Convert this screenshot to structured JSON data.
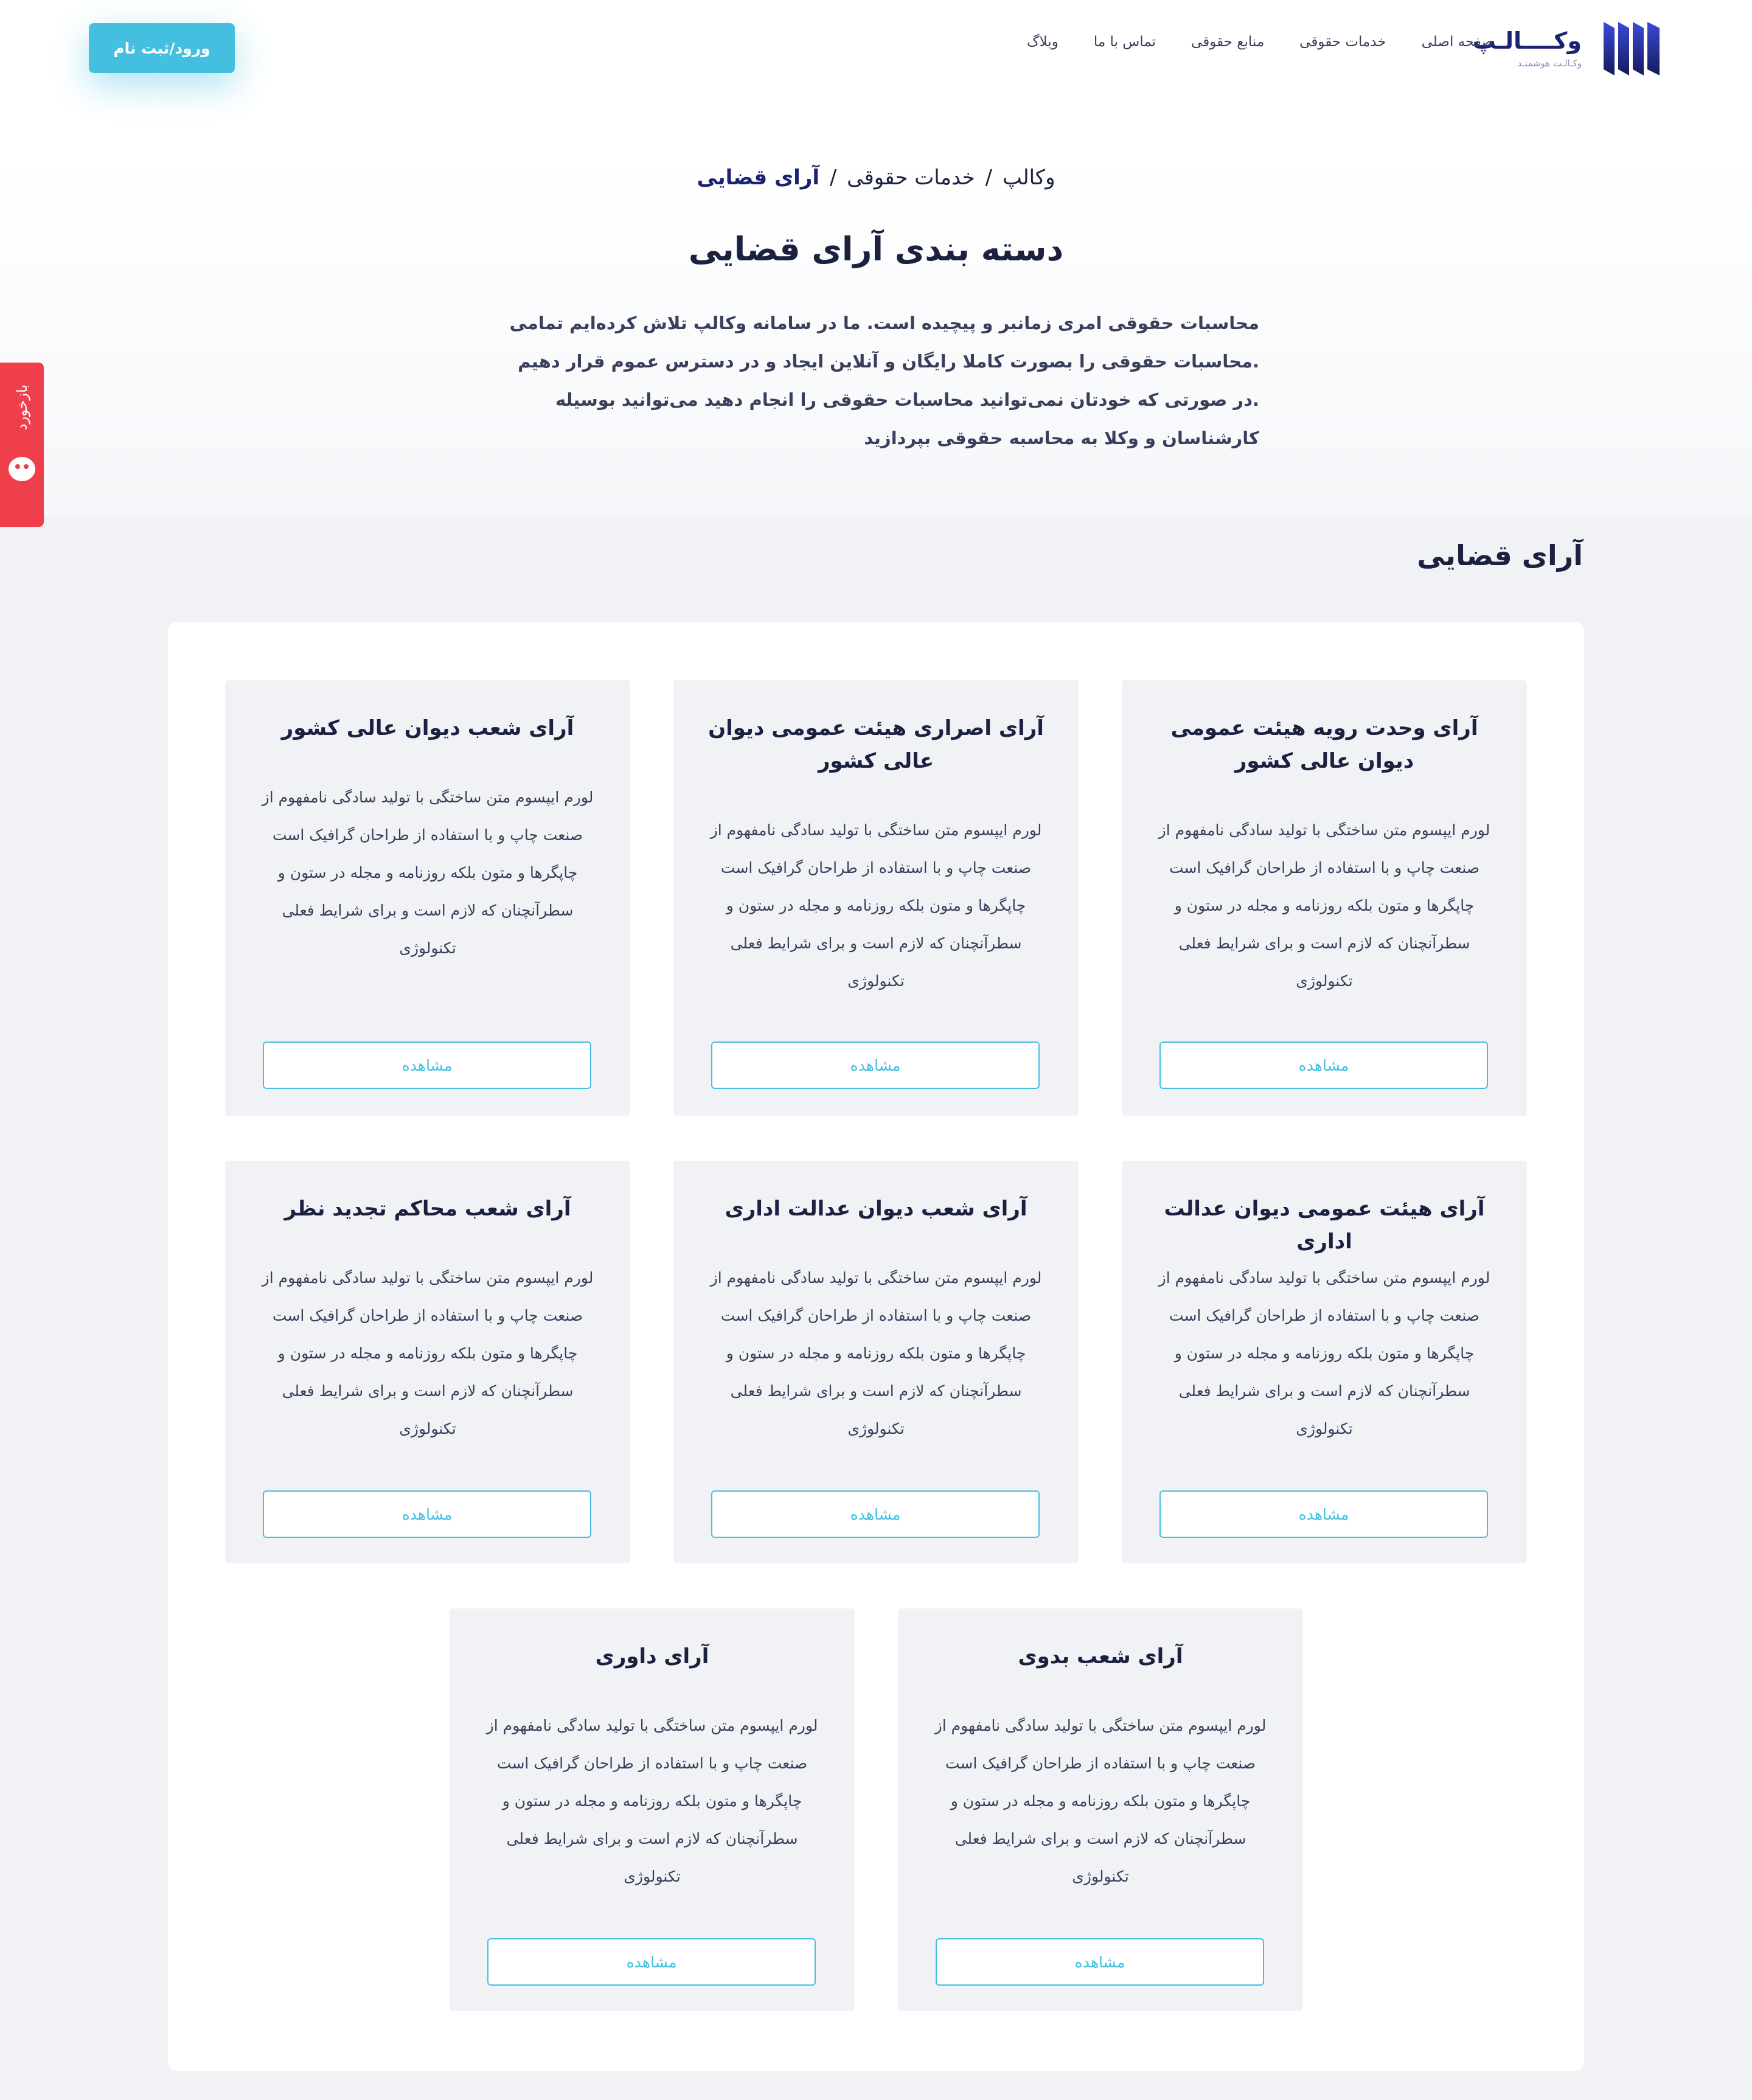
{
  "header": {
    "logo": {
      "name": "وکــــالـپ",
      "tagline": "وکـالـت هوشمنـد"
    },
    "nav": [
      "صفحه اصلی",
      "خدمات حقوقی",
      "منابع حقوقی",
      "تماس با ما",
      "وبلاگ"
    ],
    "login_label": "ورود/ثبت نام"
  },
  "breadcrumb": {
    "home": "وکالپ",
    "parent": "خدمات حقوقی",
    "current": "آرای قضایی",
    "separator": "/"
  },
  "page": {
    "title": "دسته بندی آرای قضایی",
    "intro": "محاسبات حقوقی امری زمانبر و پیچیده است. ما در سامانه وکالپ تلاش کرده‌ایم تمامی .محاسبات حقوقی را بصورت کاملا رایگان و آنلاین ایجاد و در دسترس عموم قرار دهیم .در صورتی که خودتان نمی‌توانید محاسبات حقوقی را انجام دهید می‌توانید بوسیله کارشناسان و وکلا به محاسبه حقوقی بپردازید"
  },
  "feedback": {
    "label": "بازخورد"
  },
  "section": {
    "title": "آرای قضایی"
  },
  "cards": [
    {
      "title": "آرای وحدت رویه هیئت عمومی دیوان عالی کشور",
      "text": "لورم ایپسوم متن ساختگی با تولید سادگی نامفهوم از صنعت چاپ و با استفاده از طراحان گرافیک است چاپگرها و متون بلکه روزنامه و مجله در ستون و سطرآنچنان که لازم است و برای شرایط فعلی تکنولوژی",
      "button": "مشاهده"
    },
    {
      "title": "آرای اصراری هیئت عمومی دیوان عالی کشور",
      "text": "لورم ایپسوم متن ساختگی با تولید سادگی نامفهوم از صنعت چاپ و با استفاده از طراحان گرافیک است چاپگرها و متون بلکه روزنامه و مجله در ستون و سطرآنچنان که لازم است و برای شرایط فعلی تکنولوژی",
      "button": "مشاهده"
    },
    {
      "title": "آرای شعب دیوان عالی کشور",
      "text": "لورم ایپسوم متن ساختگی با تولید سادگی نامفهوم از صنعت چاپ و با استفاده از طراحان گرافیک است چاپگرها و متون بلکه روزنامه و مجله در ستون و سطرآنچنان که لازم است و برای شرایط فعلی تکنولوژی",
      "button": "مشاهده"
    },
    {
      "title": "آرای هیئت عمومی دیوان عدالت اداری",
      "text": "لورم ایپسوم متن ساختگی با تولید سادگی نامفهوم از صنعت چاپ و با استفاده از طراحان گرافیک است چاپگرها و متون بلکه روزنامه و مجله در ستون و سطرآنچنان که لازم است و برای شرایط فعلی تکنولوژی",
      "button": "مشاهده"
    },
    {
      "title": "آرای شعب دیوان عدالت اداری",
      "text": "لورم ایپسوم متن ساختگی با تولید سادگی نامفهوم از صنعت چاپ و با استفاده از طراحان گرافیک است چاپگرها و متون بلکه روزنامه و مجله در ستون و سطرآنچنان که لازم است و برای شرایط فعلی تکنولوژی",
      "button": "مشاهده"
    },
    {
      "title": "آرای شعب محاکم تجدید نظر",
      "text": "لورم ایپسوم متن ساختگی با تولید سادگی نامفهوم از صنعت چاپ و با استفاده از طراحان گرافیک است چاپگرها و متون بلکه روزنامه و مجله در ستون و سطرآنچنان که لازم است و برای شرایط فعلی تکنولوژی",
      "button": "مشاهده"
    },
    {
      "title": "آرای شعب بدوی",
      "text": "لورم ایپسوم متن ساختگی با تولید سادگی نامفهوم از صنعت چاپ و با استفاده از طراحان گرافیک است چاپگرها و متون بلکه روزنامه و مجله در ستون و سطرآنچنان که لازم است و برای شرایط فعلی تکنولوژی",
      "button": "مشاهده"
    },
    {
      "title": "آرای داوری",
      "text": "لورم ایپسوم متن ساختگی با تولید سادگی نامفهوم از صنعت چاپ و با استفاده از طراحان گرافیک است چاپگرها و متون بلکه روزنامه و مجله در ستون و سطرآنچنان که لازم است و برای شرایط فعلی تکنولوژی",
      "button": "مشاهده"
    }
  ],
  "colors": {
    "accent": "#45bfe0",
    "brand": "#1a2370",
    "feedback": "#ef3f4a",
    "card_bg": "#f1f2f6"
  },
  "icons": {
    "logo": "logo-mark-icon",
    "feedback": "smile-icon"
  }
}
